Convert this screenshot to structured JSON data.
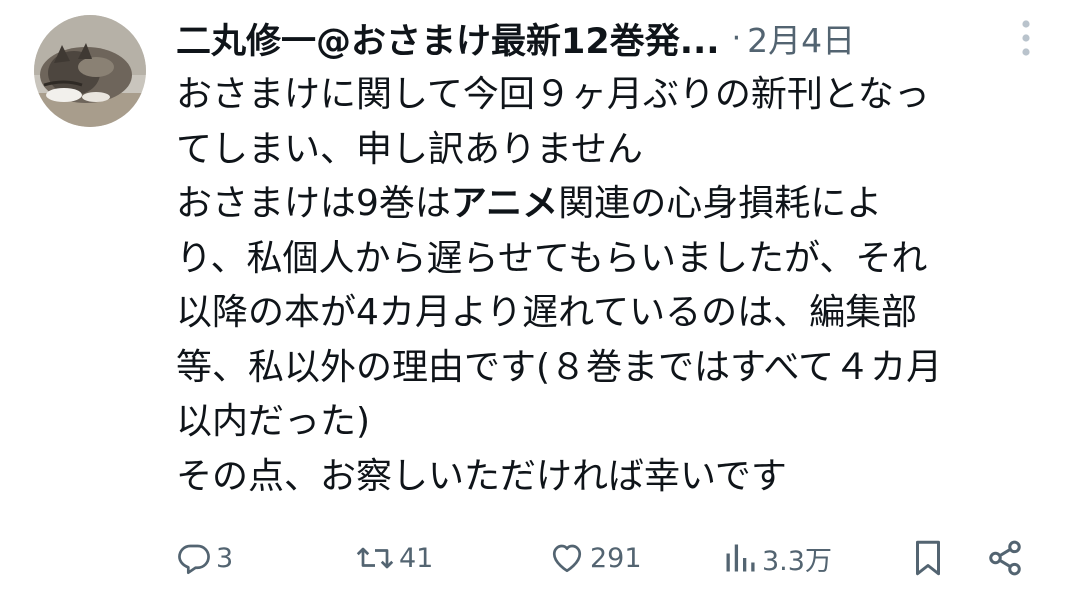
{
  "tweet": {
    "display_name": "二丸修一@おさまけ最新12巻発...",
    "separator": "·",
    "timestamp": "2月4日",
    "body_lines": [
      {
        "before": "おさまけに関して今回９ヶ月ぶりの新刊となっ",
        "bold": "",
        "after": ""
      },
      {
        "before": "てしまい、申し訳ありません",
        "bold": "",
        "after": ""
      },
      {
        "before": "おさまけは9巻は",
        "bold": "アニメ",
        "after": "関連の心身損耗によ"
      },
      {
        "before": "り、私個人から遅らせてもらいましたが、それ",
        "bold": "",
        "after": ""
      },
      {
        "before": "以降の本が4カ月より遅れているのは、編集部",
        "bold": "",
        "after": ""
      },
      {
        "before": "等、私以外の理由です(８巻まではすべて４カ月",
        "bold": "",
        "after": ""
      },
      {
        "before": "以内だった)",
        "bold": "",
        "after": ""
      },
      {
        "before": "その点、お察しいただければ幸いです",
        "bold": "",
        "after": ""
      }
    ]
  },
  "actions": {
    "reply": {
      "icon": "reply-icon",
      "count": "3"
    },
    "retweet": {
      "icon": "retweet-icon",
      "count": "41"
    },
    "like": {
      "icon": "heart-icon",
      "count": "291"
    },
    "views": {
      "icon": "views-icon",
      "count": "3.3万"
    },
    "bookmark": {
      "icon": "bookmark-icon"
    },
    "share": {
      "icon": "share-icon"
    }
  },
  "colors": {
    "text": "#0f1419",
    "secondary": "#536471",
    "more_icon": "#b9c3cc"
  }
}
